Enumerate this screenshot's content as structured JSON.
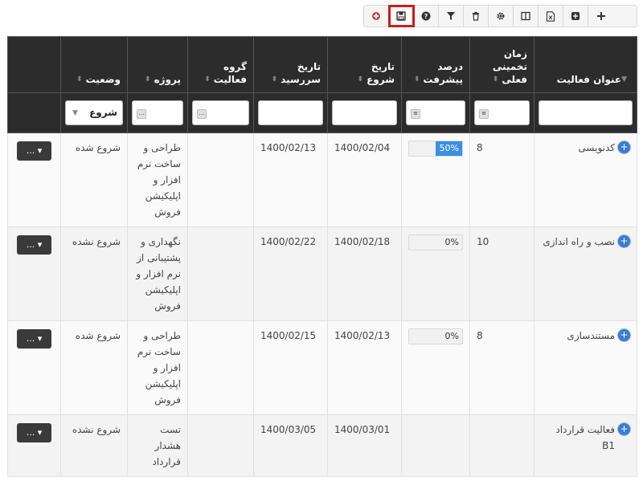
{
  "toolbar": {
    "buttons": [
      {
        "icon": "plus-icon",
        "glyph": "+"
      },
      {
        "icon": "add-box-icon",
        "glyph": "⊞"
      },
      {
        "icon": "excel-export-icon",
        "glyph": "X"
      },
      {
        "icon": "columns-icon",
        "glyph": "▥"
      },
      {
        "icon": "gear-icon",
        "glyph": "⚙"
      },
      {
        "icon": "trash-icon",
        "glyph": "🗑"
      },
      {
        "icon": "filter-icon",
        "glyph": "▼"
      },
      {
        "icon": "help-icon",
        "glyph": "?"
      },
      {
        "icon": "save-icon",
        "glyph": "💾"
      },
      {
        "icon": "reset-icon",
        "glyph": "↺"
      }
    ],
    "accent_color": "#d0191b"
  },
  "columns": [
    {
      "key": "title",
      "label": "عنوان فعالیت"
    },
    {
      "key": "est",
      "label": "زمان تخمینی فعلی"
    },
    {
      "key": "progress",
      "label": "درصد پیشرفت"
    },
    {
      "key": "start",
      "label": "تاریخ شروع"
    },
    {
      "key": "due",
      "label": "تاریخ سررسید"
    },
    {
      "key": "group",
      "label": "گروه فعالیت"
    },
    {
      "key": "project",
      "label": "پروژه"
    },
    {
      "key": "status",
      "label": "وضعیت"
    }
  ],
  "filters": {
    "status_value": "شروع"
  },
  "rows": [
    {
      "title": "کدنویسی",
      "est": "8",
      "progress": 50,
      "progress_label": "50%",
      "start": "1400/02/04",
      "due": "1400/02/13",
      "group": "",
      "project": "طراحی و ساخت نرم افزار و اپلیکیشن فروش",
      "status": "شروع شده",
      "action": "..."
    },
    {
      "title": "نصب و راه اندازی",
      "est": "10",
      "progress": 0,
      "progress_label": "0%",
      "start": "1400/02/18",
      "due": "1400/02/22",
      "group": "",
      "project": "نگهداری و پشتیبانی از نرم افزار و اپلیکیشن فروش",
      "status": "شروع نشده",
      "action": "..."
    },
    {
      "title": "مستندسازی",
      "est": "8",
      "progress": 0,
      "progress_label": "0%",
      "start": "1400/02/13",
      "due": "1400/02/15",
      "group": "",
      "project": "طراحی و ساخت نرم افزار و اپلیکیشن فروش",
      "status": "شروع شده",
      "action": "..."
    },
    {
      "title": "فعالیت قرارداد B1",
      "est": "",
      "progress": null,
      "progress_label": "",
      "start": "1400/03/01",
      "due": "1400/03/05",
      "group": "",
      "project": "تست هشدار قرارداد",
      "status": "شروع نشده",
      "action": "..."
    }
  ],
  "colors": {
    "header_bg": "#2c2c2c",
    "progress_fill": "#3a8ee6",
    "expand_icon": "#3a7bd5"
  }
}
